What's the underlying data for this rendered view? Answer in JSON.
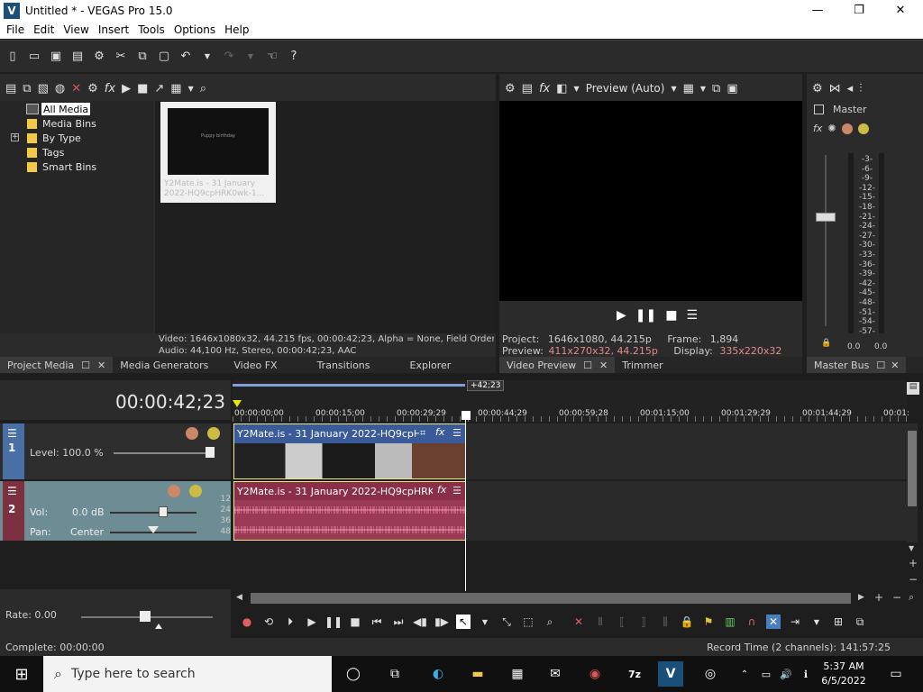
{
  "window": {
    "title": "Untitled * - VEGAS Pro 15.0",
    "logo_letter": "V",
    "minimize": "—",
    "maximize": "❐",
    "close": "✕"
  },
  "menu": [
    "File",
    "Edit",
    "View",
    "Insert",
    "Tools",
    "Options",
    "Help"
  ],
  "project_media": {
    "tree": [
      {
        "label": "All Media",
        "selected": true
      },
      {
        "label": "Media Bins"
      },
      {
        "label": "By Type",
        "expandable": true,
        "expand_symbol": "+"
      },
      {
        "label": "Tags"
      },
      {
        "label": "Smart Bins"
      }
    ],
    "thumb_caption": "Y2Mate.is - 31 January 2022-HQ9cpHRK0wk-1...",
    "thumb_inner_text": "Puppy birthday",
    "info_line1": "Video: 1646x1080x32, 44.215 fps, 00:00:42;23, Alpha = None, Field Order =",
    "info_line2": "Audio: 44,100 Hz, Stereo, 00:00:42;23, AAC"
  },
  "panel_tabs_left": [
    {
      "label": "Project Media",
      "active": true
    },
    {
      "label": "Media Generators"
    },
    {
      "label": "Video FX"
    },
    {
      "label": "Transitions"
    },
    {
      "label": "Explorer"
    }
  ],
  "preview": {
    "mode_label": "Preview (Auto)",
    "project_label": "Project:",
    "project_value": "1646x1080, 44.215p",
    "frame_label": "Frame:",
    "frame_value": "1,894",
    "preview_label": "Preview:",
    "preview_value": "411x270x32, 44.215p",
    "display_label": "Display:",
    "display_value": "335x220x32",
    "tabs": [
      {
        "label": "Video Preview",
        "active": true
      },
      {
        "label": "Trimmer"
      }
    ]
  },
  "master_bus": {
    "title": "Master",
    "fx_label": "fx",
    "scale": [
      "3",
      "6",
      "9",
      "12",
      "15",
      "18",
      "21",
      "24",
      "27",
      "30",
      "33",
      "36",
      "39",
      "42",
      "45",
      "48",
      "51",
      "54",
      "57"
    ],
    "left_value": "0.0",
    "right_value": "0.0",
    "tab": "Master Bus"
  },
  "timeline": {
    "timecode": "00:00:42;23",
    "ruler": [
      "00:00:00;00",
      "00:00:15;00",
      "00:00:29;29",
      "00:00:44;29",
      "00:00:59;28",
      "00:01:15;00",
      "00:01:29;29",
      "00:01:44;29",
      "00:01:"
    ],
    "cursor_badge": "+42;23",
    "video_track": {
      "number": "1",
      "level_label": "Level: 100.0 %",
      "level_fraction": 1.0,
      "clip_title": "Y2Mate.is - 31 January 2022-HQ9cpH..."
    },
    "audio_track": {
      "number": "2",
      "vol_label": "Vol:",
      "vol_value": "0.0 dB",
      "pan_label": "Pan:",
      "pan_value": "Center",
      "meter": [
        "12",
        "24",
        "36",
        "48"
      ],
      "clip_title": "Y2Mate.is - 31 January 2022-HQ9cpHRK0..."
    },
    "rate_label": "Rate: 0.00"
  },
  "status": {
    "left": "Complete: 00:00:00",
    "right": "Record Time (2 channels): 141:57:25"
  },
  "taskbar": {
    "search_placeholder": "Type here to search",
    "time": "5:37 AM",
    "date": "6/5/2022"
  },
  "colors": {
    "accent_blue": "#4a6fa5",
    "audio_track": "#7d3040",
    "clip_video": "#3b5a9a",
    "clip_audio": "#8a2f47",
    "waveform": "#c45a78",
    "selection": "#e6e68c"
  }
}
